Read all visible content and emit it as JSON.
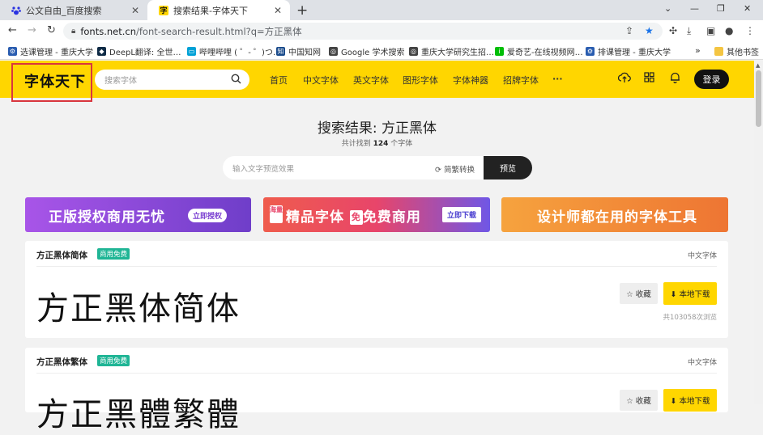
{
  "browser": {
    "tabs": [
      {
        "title": "公文自由_百度搜索",
        "close": "✕"
      },
      {
        "title": "搜索结果-字体天下",
        "close": "✕"
      }
    ],
    "new_tab": "+",
    "url_domain": "fonts.net.cn",
    "url_path": "/font-search-result.html?q=方正黑体",
    "window_controls": [
      "⌄",
      "—",
      "❐",
      "✕"
    ]
  },
  "bookmarks": [
    {
      "label": "选课管理 - 重庆大学",
      "color": "#2a5db0"
    },
    {
      "label": "DeepL翻译: 全世…",
      "color": "#0f2b46"
    },
    {
      "label": "哔哩哔哩 ( ゜- ゜)つ…",
      "color": "#00a1d6"
    },
    {
      "label": "中国知网",
      "color": "#1b4c8c"
    },
    {
      "label": "Google 学术搜索",
      "color": "#444444"
    },
    {
      "label": "重庆大学研究生招…",
      "color": "#444444"
    },
    {
      "label": "爱奇艺-在线视频网…",
      "color": "#00be06"
    },
    {
      "label": "排课管理 - 重庆大学",
      "color": "#2a5db0"
    }
  ],
  "bookmarks_more": "»",
  "bookmarks_other": "其他书签",
  "header": {
    "logo": "字体天下",
    "search_placeholder": "搜索字体",
    "nav": [
      "首页",
      "中文字体",
      "英文字体",
      "图形字体",
      "字体神器",
      "招牌字体",
      "···"
    ],
    "login": "登录"
  },
  "result": {
    "title": "搜索结果: 方正黑体",
    "count_prefix": "共计找到",
    "count": "124",
    "count_suffix": "个字体",
    "preview_placeholder": "输入文字预览效果",
    "convert_label": "简繁转换",
    "preview_button": "预览"
  },
  "banners": [
    {
      "text": "正版授权商用无忧",
      "button": "立即授权"
    },
    {
      "tag": "海量",
      "text": "精品字体",
      "text2": "免费商用",
      "button": "立即下载"
    },
    {
      "text": "设计师都在用的字体工具"
    }
  ],
  "fonts": [
    {
      "name": "方正黑体简体",
      "badge": "商用免费",
      "category": "中文字体",
      "sample": "方正黑体简体",
      "fav": "☆ 收藏",
      "download": "⬇ 本地下载",
      "views": "共103058次浏览"
    },
    {
      "name": "方正黑体繁体",
      "badge": "商用免费",
      "category": "中文字体",
      "sample": "方正黑體繁體",
      "fav": "☆ 收藏",
      "download": "⬇ 本地下载"
    }
  ],
  "accent_color": "#ffd600"
}
